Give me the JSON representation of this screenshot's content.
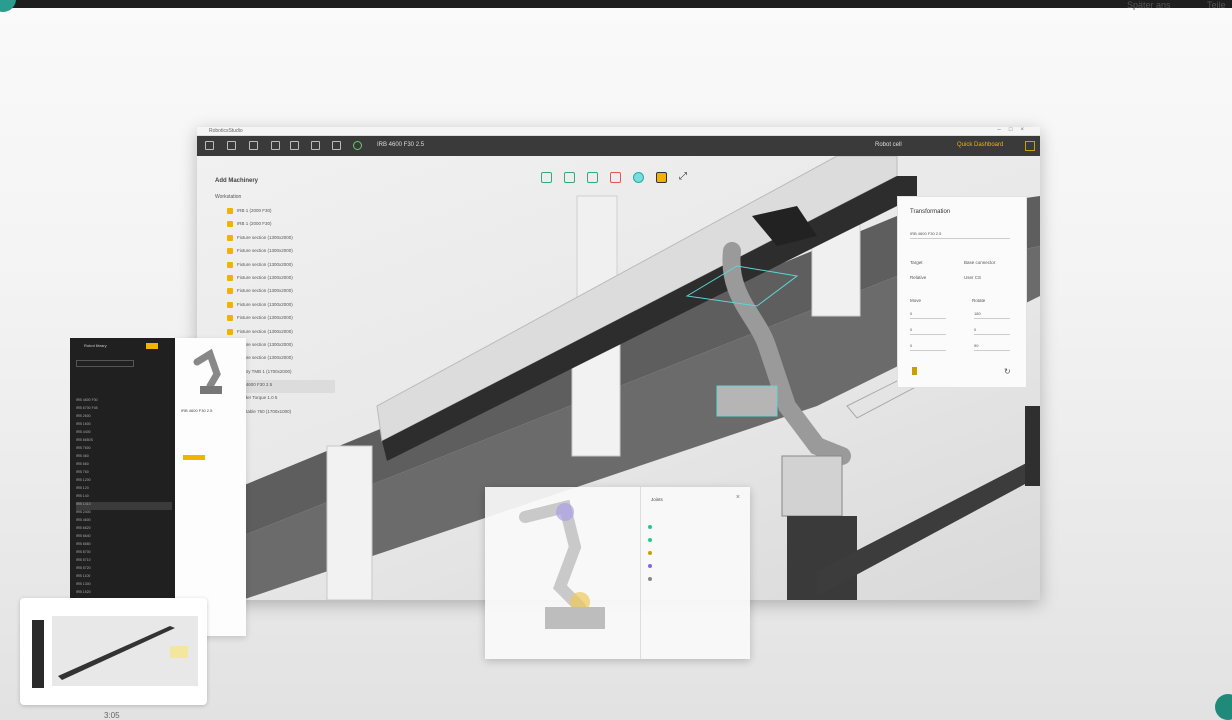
{
  "browser": {
    "later_label": "Später ans",
    "share_label": "Teile"
  },
  "app": {
    "window_title": "RoboticsStudio",
    "toolbar_title": "IRB 4600 F30 2.5",
    "mode_label": "Robot cell",
    "user_label": "Quick Dashboard",
    "tree": {
      "title": "Add Machinery",
      "section": "Workstation",
      "items": [
        "IRB 1 (2000 F30)",
        "IRB 1 (2000 F30)",
        "Fixture section (1300x2000)",
        "Fixture section (1300x2000)",
        "Fixture section (1300x2000)",
        "Fixture section (1300x2000)",
        "Fixture section (1300x2000)",
        "Fixture section (1300x2000)",
        "Fixture section (1300x2000)",
        "Fixture section (1300x2000)",
        "Fixture section (1300x2000)",
        "Fixture section (1300x2000)",
        "Gantry TMB 1 (1700x2000)",
        "IRB 4600 F30 2.5",
        "Welder Torque 1.0 5",
        "Turntable 750 (1700x1000)"
      ]
    },
    "transform": {
      "title": "Transformation",
      "object_name": "IRB 4600 F30 2.5",
      "target_label": "Target",
      "target_value": "Base connector",
      "relative_label": "Relative",
      "relative_value": "User CS",
      "move_label": "Move",
      "rotate_label": "Rotate",
      "move_values": [
        "0",
        "0",
        "0"
      ],
      "rotate_values": [
        "180",
        "0",
        "90"
      ]
    }
  },
  "overlay": {
    "title": "Joints"
  },
  "list_panel": {
    "title": "Robot library",
    "rows": [
      "IRB 4600 F30",
      "IRB 6700 F45",
      "IRB 2600",
      "IRB 1600",
      "IRB 4400",
      "IRB 6650S",
      "IRB 7600",
      "IRB 460",
      "IRB 660",
      "IRB 760",
      "IRB 1200",
      "IRB 120",
      "IRB 140",
      "IRB 1410",
      "IRB 2400",
      "IRB 4600",
      "IRB 6620",
      "IRB 6640",
      "IRB 6660",
      "IRB 8700",
      "IRB 5710",
      "IRB 5720",
      "IRB 1100",
      "IRB 1300",
      "IRB 1520"
    ],
    "detail_title": "IRB 4600 F30 2.5"
  },
  "thumbnail": {
    "time": "3:05"
  }
}
